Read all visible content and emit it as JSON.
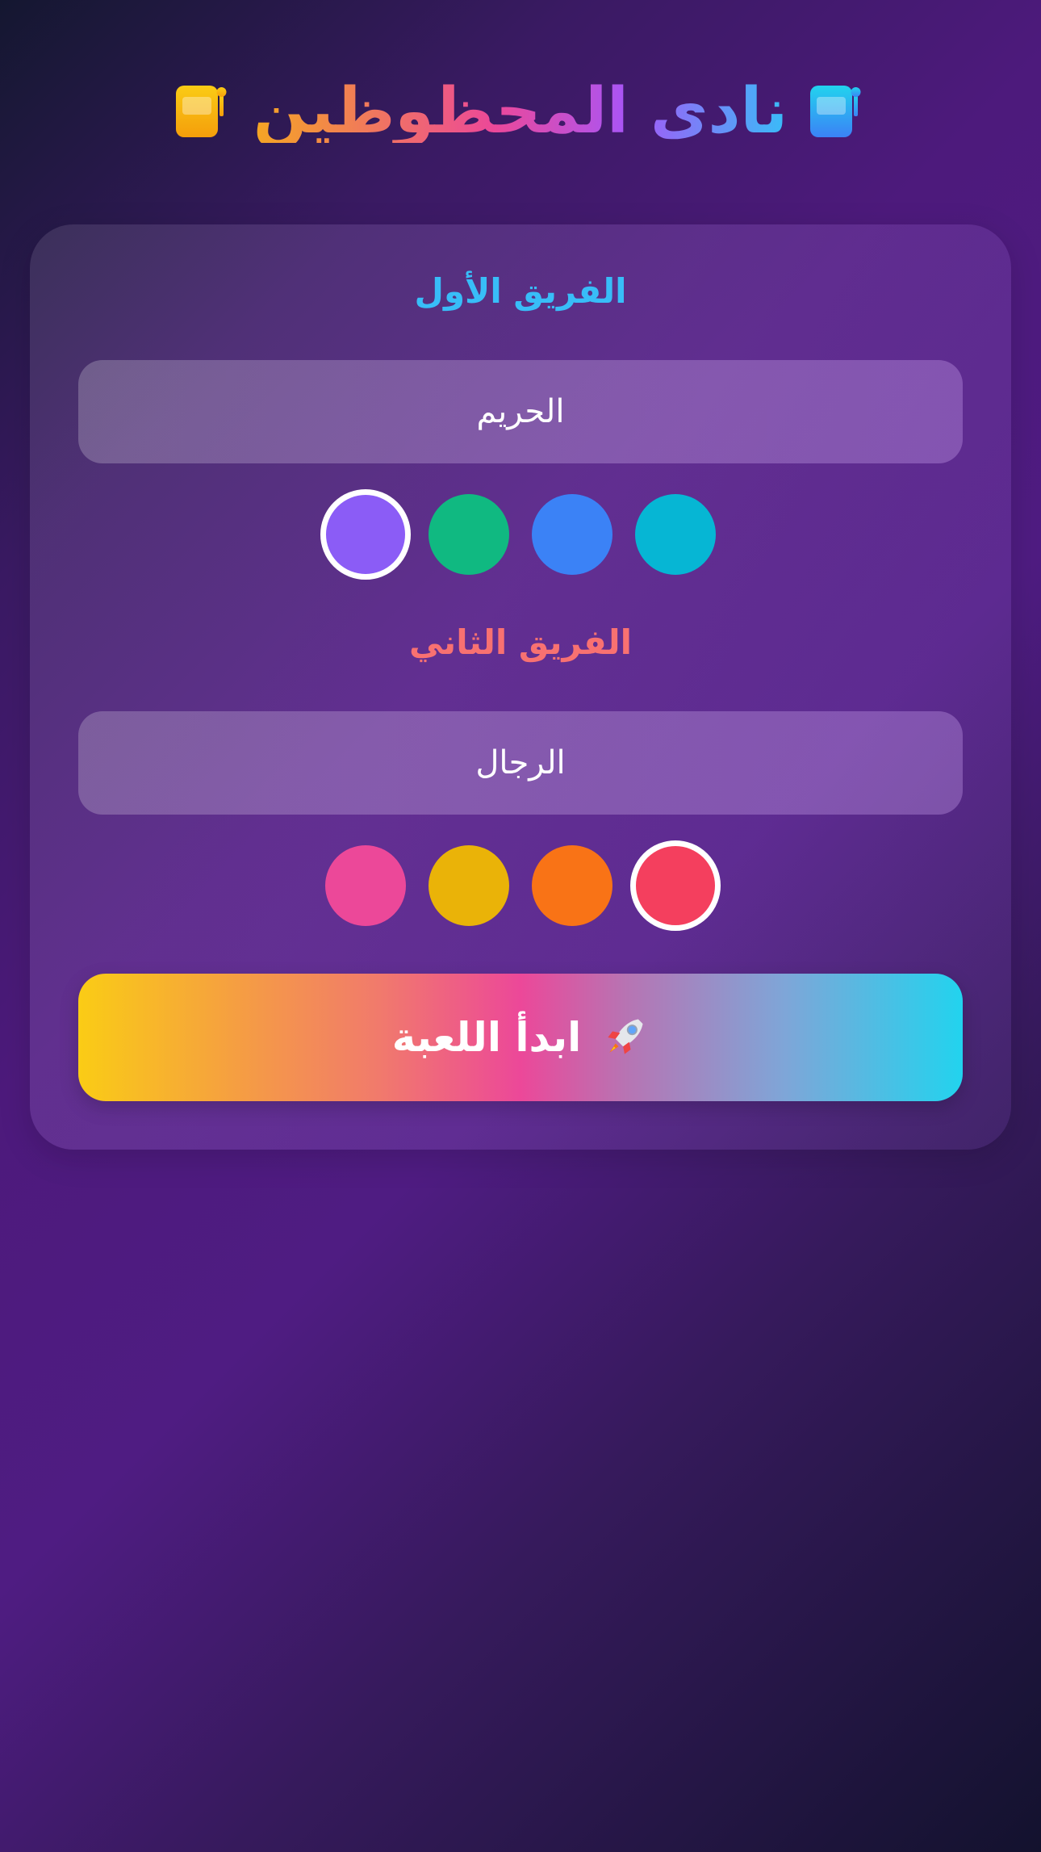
{
  "header": {
    "title": "نادي المحظوظين",
    "icon_left": "slot-machine-icon",
    "icon_right": "slot-machine-icon"
  },
  "team1": {
    "label": "الفريق الأول",
    "label_color": "#38bdf8",
    "name_value": "الحريم",
    "colors": [
      {
        "name": "cyan",
        "hex": "#06b6d4",
        "selected": false
      },
      {
        "name": "blue",
        "hex": "#3b82f6",
        "selected": false
      },
      {
        "name": "green",
        "hex": "#10b981",
        "selected": false
      },
      {
        "name": "violet",
        "hex": "#8b5cf6",
        "selected": true
      }
    ]
  },
  "team2": {
    "label": "الفريق الثاني",
    "label_color": "#f87171",
    "name_value": "الرجال",
    "colors": [
      {
        "name": "red",
        "hex": "#f43f5e",
        "selected": true
      },
      {
        "name": "orange",
        "hex": "#f97316",
        "selected": false
      },
      {
        "name": "yellow",
        "hex": "#eab308",
        "selected": false
      },
      {
        "name": "pink",
        "hex": "#ec4899",
        "selected": false
      }
    ]
  },
  "start": {
    "label": "ابدأ اللعبة",
    "icon": "rocket-icon"
  }
}
